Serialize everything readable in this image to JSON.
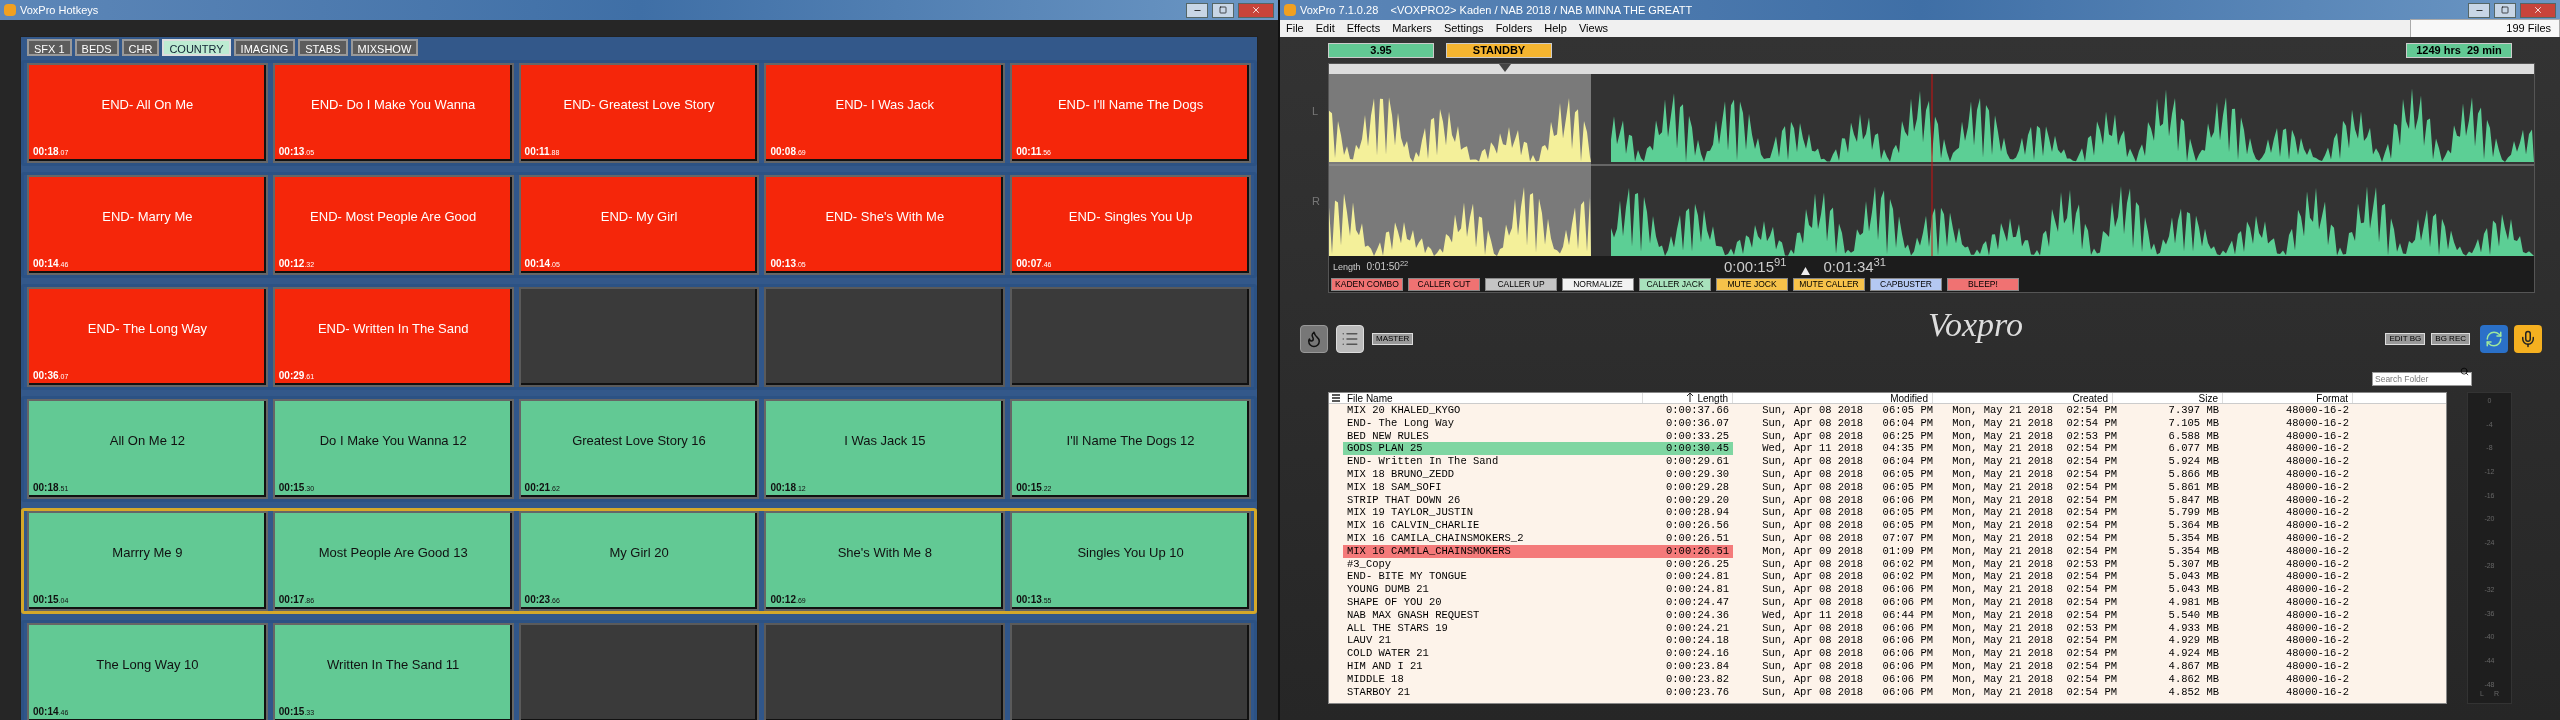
{
  "hotkeys_window": {
    "title": "VoxPro Hotkeys",
    "tabs": [
      {
        "label": "SFX 1",
        "selected": false
      },
      {
        "label": "BEDS",
        "selected": false
      },
      {
        "label": "CHR",
        "selected": false
      },
      {
        "label": "COUNTRY",
        "selected": true
      },
      {
        "label": "IMAGING",
        "selected": false
      },
      {
        "label": "STABS",
        "selected": false
      },
      {
        "label": "MIXSHOW",
        "selected": false
      }
    ],
    "rows": [
      {
        "selected": false,
        "carts": [
          {
            "kind": "loaded",
            "color": "#f5260a",
            "title": "END- All On Me",
            "time": "00:18",
            "fraction": ".07"
          },
          {
            "kind": "loaded",
            "color": "#f5260a",
            "title": "END- Do I Make You Wanna",
            "time": "00:13",
            "fraction": ".05"
          },
          {
            "kind": "loaded",
            "color": "#f5260a",
            "title": "END- Greatest Love Story",
            "time": "00:11",
            "fraction": ".88"
          },
          {
            "kind": "loaded",
            "color": "#f5260a",
            "title": "END- I Was Jack",
            "time": "00:08",
            "fraction": ".69"
          },
          {
            "kind": "loaded",
            "color": "#f5260a",
            "title": "END- I'll Name The Dogs",
            "time": "00:11",
            "fraction": ".56"
          }
        ]
      },
      {
        "selected": false,
        "carts": [
          {
            "kind": "loaded",
            "color": "#f5260a",
            "title": "END- Marry Me",
            "time": "00:14",
            "fraction": ".46"
          },
          {
            "kind": "loaded",
            "color": "#f5260a",
            "title": "END- Most People Are Good",
            "time": "00:12",
            "fraction": ".32"
          },
          {
            "kind": "loaded",
            "color": "#f5260a",
            "title": "END- My Girl",
            "time": "00:14",
            "fraction": ".05"
          },
          {
            "kind": "loaded",
            "color": "#f5260a",
            "title": "END- She's With Me",
            "time": "00:13",
            "fraction": ".05"
          },
          {
            "kind": "loaded",
            "color": "#f5260a",
            "title": "END- Singles You Up",
            "time": "00:07",
            "fraction": ".46"
          }
        ]
      },
      {
        "selected": false,
        "carts": [
          {
            "kind": "loaded",
            "color": "#f5260a",
            "title": "END- The Long Way",
            "time": "00:36",
            "fraction": ".07"
          },
          {
            "kind": "loaded",
            "color": "#f5260a",
            "title": "END- Written In The Sand",
            "time": "00:29",
            "fraction": ".61"
          },
          {
            "kind": "empty"
          },
          {
            "kind": "empty"
          },
          {
            "kind": "empty"
          }
        ]
      },
      {
        "selected": false,
        "carts": [
          {
            "kind": "loaded",
            "color": "#62c994",
            "title": "All On Me 12",
            "time": "00:18",
            "fraction": ".51"
          },
          {
            "kind": "loaded",
            "color": "#62c994",
            "title": "Do I Make You Wanna 12",
            "time": "00:15",
            "fraction": ".30"
          },
          {
            "kind": "loaded",
            "color": "#62c994",
            "title": "Greatest Love Story 16",
            "time": "00:21",
            "fraction": ".62"
          },
          {
            "kind": "loaded",
            "color": "#62c994",
            "title": "I Was Jack 15",
            "time": "00:18",
            "fraction": ".12"
          },
          {
            "kind": "loaded",
            "color": "#62c994",
            "title": "I'll Name The Dogs 12",
            "time": "00:15",
            "fraction": ".22"
          }
        ]
      },
      {
        "selected": true,
        "carts": [
          {
            "kind": "loaded",
            "color": "#62c994",
            "title": "Marrry Me 9",
            "time": "00:15",
            "fraction": ".04"
          },
          {
            "kind": "loaded",
            "color": "#62c994",
            "title": "Most People Are Good 13",
            "time": "00:17",
            "fraction": ".86"
          },
          {
            "kind": "loaded",
            "color": "#62c994",
            "title": "My Girl 20",
            "time": "00:23",
            "fraction": ".66"
          },
          {
            "kind": "loaded",
            "color": "#62c994",
            "title": "She's With Me 8",
            "time": "00:12",
            "fraction": ".69"
          },
          {
            "kind": "loaded",
            "color": "#62c994",
            "title": "Singles You Up 10",
            "time": "00:13",
            "fraction": ".55"
          }
        ]
      },
      {
        "selected": false,
        "carts": [
          {
            "kind": "loaded",
            "color": "#62c994",
            "title": "The Long Way 10",
            "time": "00:14",
            "fraction": ".46"
          },
          {
            "kind": "loaded",
            "color": "#62c994",
            "title": "Written In The Sand 11",
            "time": "00:15",
            "fraction": ".33"
          },
          {
            "kind": "empty"
          },
          {
            "kind": "empty"
          },
          {
            "kind": "empty"
          }
        ]
      }
    ]
  },
  "editor_window": {
    "title": "VoxPro 7.1.0.28    <VOXPRO2> Kaden / NAB 2018 / NAB MINNA THE GREATT",
    "menu": [
      "File",
      "Edit",
      "Effects",
      "Markers",
      "Settings",
      "Folders",
      "Help",
      "Views"
    ],
    "file_count": "199 Files",
    "gain": "3.95",
    "status": "STANDBY",
    "remaining": "1249 hrs  29 min",
    "channels": [
      "L",
      "R"
    ],
    "length_label": "Length",
    "length": "0:01:50$^{22}$",
    "position": "0:00:15$^{91}$",
    "end_time": "0:01:34$^{31}$",
    "effects": [
      {
        "label": "KADEN COMBO",
        "color": "#f07272"
      },
      {
        "label": "CALLER CUT",
        "color": "#f07272"
      },
      {
        "label": "CALLER UP",
        "color": "#c4c4c4"
      },
      {
        "label": "NORMALIZE",
        "color": "#f2f2f2"
      },
      {
        "label": "CALLER JACK",
        "color": "#a8e2bc"
      },
      {
        "label": "MUTE JOCK",
        "color": "#f6c24a"
      },
      {
        "label": "MUTE CALLER",
        "color": "#f6c24a"
      },
      {
        "label": "CAPBUSTER",
        "color": "#b4c8f2"
      },
      {
        "label": "BLEEP!",
        "color": "#f07272"
      }
    ],
    "logo": "Voxpro",
    "master_button": "MASTER",
    "edit_bg_button": "EDIT BG",
    "bg_rec_button": "BG REC",
    "search": {
      "placeholder": "Search Folder"
    },
    "columns": [
      "File Name",
      "Length",
      "Modified",
      "Created",
      "Size",
      "Format"
    ],
    "files": [
      {
        "cells": [
          "MIX 20 KHALED_KYGO",
          "0:00:37.66",
          "Sun, Apr 08 2018",
          "06:05 PM",
          "Mon, May 21 2018",
          "02:54 PM",
          "7.397 MB",
          "48000-16-2"
        ]
      },
      {
        "cells": [
          "END- The Long Way",
          "0:00:36.07",
          "Sun, Apr 08 2018",
          "06:04 PM",
          "Mon, May 21 2018",
          "02:54 PM",
          "7.105 MB",
          "48000-16-2"
        ]
      },
      {
        "cells": [
          "BED NEW RULES",
          "0:00:33.25",
          "Sun, Apr 08 2018",
          "06:25 PM",
          "Mon, May 21 2018",
          "02:53 PM",
          "6.588 MB",
          "48000-16-2"
        ]
      },
      {
        "color": "#7fd6a2",
        "cells": [
          "GODS PLAN 25",
          "0:00:30.45",
          "Wed, Apr 11 2018",
          "04:35 PM",
          "Mon, May 21 2018",
          "02:54 PM",
          "6.077 MB",
          "48000-16-2"
        ]
      },
      {
        "cells": [
          "END- Written In The Sand",
          "0:00:29.61",
          "Sun, Apr 08 2018",
          "06:04 PM",
          "Mon, May 21 2018",
          "02:54 PM",
          "5.924 MB",
          "48000-16-2"
        ]
      },
      {
        "cells": [
          "MIX 18 BRUNO_ZEDD",
          "0:00:29.30",
          "Sun, Apr 08 2018",
          "06:05 PM",
          "Mon, May 21 2018",
          "02:54 PM",
          "5.866 MB",
          "48000-16-2"
        ]
      },
      {
        "cells": [
          "MIX 18 SAM_SOFI",
          "0:00:29.28",
          "Sun, Apr 08 2018",
          "06:05 PM",
          "Mon, May 21 2018",
          "02:54 PM",
          "5.861 MB",
          "48000-16-2"
        ]
      },
      {
        "cells": [
          "STRIP THAT DOWN 26",
          "0:00:29.20",
          "Sun, Apr 08 2018",
          "06:06 PM",
          "Mon, May 21 2018",
          "02:54 PM",
          "5.847 MB",
          "48000-16-2"
        ]
      },
      {
        "cells": [
          "MIX 19 TAYLOR_JUSTIN",
          "0:00:28.94",
          "Sun, Apr 08 2018",
          "06:05 PM",
          "Mon, May 21 2018",
          "02:54 PM",
          "5.799 MB",
          "48000-16-2"
        ]
      },
      {
        "cells": [
          "MIX 16 CALVIN_CHARLIE",
          "0:00:26.56",
          "Sun, Apr 08 2018",
          "06:05 PM",
          "Mon, May 21 2018",
          "02:54 PM",
          "5.364 MB",
          "48000-16-2"
        ]
      },
      {
        "cells": [
          "MIX 16 CAMILA_CHAINSMOKERS_2",
          "0:00:26.51",
          "Sun, Apr 08 2018",
          "07:07 PM",
          "Mon, May 21 2018",
          "02:54 PM",
          "5.354 MB",
          "48000-16-2"
        ]
      },
      {
        "color": "#f47a7a",
        "cells": [
          "MIX 16 CAMILA_CHAINSMOKERS",
          "0:00:26.51",
          "Mon, Apr 09 2018",
          "01:09 PM",
          "Mon, May 21 2018",
          "02:54 PM",
          "5.354 MB",
          "48000-16-2"
        ]
      },
      {
        "cells": [
          "#3_Copy",
          "0:00:26.25",
          "Sun, Apr 08 2018",
          "06:02 PM",
          "Mon, May 21 2018",
          "02:53 PM",
          "5.307 MB",
          "48000-16-2"
        ]
      },
      {
        "cells": [
          "END- BITE MY TONGUE",
          "0:00:24.81",
          "Sun, Apr 08 2018",
          "06:02 PM",
          "Mon, May 21 2018",
          "02:54 PM",
          "5.043 MB",
          "48000-16-2"
        ]
      },
      {
        "cells": [
          "YOUNG DUMB 21",
          "0:00:24.81",
          "Sun, Apr 08 2018",
          "06:06 PM",
          "Mon, May 21 2018",
          "02:54 PM",
          "5.043 MB",
          "48000-16-2"
        ]
      },
      {
        "cells": [
          "SHAPE OF YOU 20",
          "0:00:24.47",
          "Sun, Apr 08 2018",
          "06:06 PM",
          "Mon, May 21 2018",
          "02:54 PM",
          "4.981 MB",
          "48000-16-2"
        ]
      },
      {
        "cells": [
          "NAB MAX GNASH REQUEST",
          "0:00:24.36",
          "Wed, Apr 11 2018",
          "06:44 PM",
          "Mon, May 21 2018",
          "02:54 PM",
          "5.540 MB",
          "48000-16-2"
        ]
      },
      {
        "cells": [
          "ALL THE STARS 19",
          "0:00:24.21",
          "Sun, Apr 08 2018",
          "06:06 PM",
          "Mon, May 21 2018",
          "02:53 PM",
          "4.933 MB",
          "48000-16-2"
        ]
      },
      {
        "cells": [
          "LAUV 21",
          "0:00:24.18",
          "Sun, Apr 08 2018",
          "06:06 PM",
          "Mon, May 21 2018",
          "02:54 PM",
          "4.929 MB",
          "48000-16-2"
        ]
      },
      {
        "cells": [
          "COLD WATER 21",
          "0:00:24.16",
          "Sun, Apr 08 2018",
          "06:06 PM",
          "Mon, May 21 2018",
          "02:54 PM",
          "4.924 MB",
          "48000-16-2"
        ]
      },
      {
        "cells": [
          "HIM AND I 21",
          "0:00:23.84",
          "Sun, Apr 08 2018",
          "06:06 PM",
          "Mon, May 21 2018",
          "02:54 PM",
          "4.867 MB",
          "48000-16-2"
        ]
      },
      {
        "cells": [
          "MIDDLE 18",
          "0:00:23.82",
          "Sun, Apr 08 2018",
          "06:06 PM",
          "Mon, May 21 2018",
          "02:54 PM",
          "4.862 MB",
          "48000-16-2"
        ]
      },
      {
        "cells": [
          "STARBOY 21",
          "0:00:23.76",
          "Sun, Apr 08 2018",
          "06:06 PM",
          "Mon, May 21 2018",
          "02:54 PM",
          "4.852 MB",
          "48000-16-2"
        ]
      }
    ],
    "meter_scale": [
      "0",
      "-4",
      "-8",
      "-12",
      "-16",
      "-20",
      "-24",
      "-28",
      "-32",
      "-36",
      "-40",
      "-44",
      "-48"
    ],
    "meter_channels": [
      "L",
      "R"
    ]
  }
}
